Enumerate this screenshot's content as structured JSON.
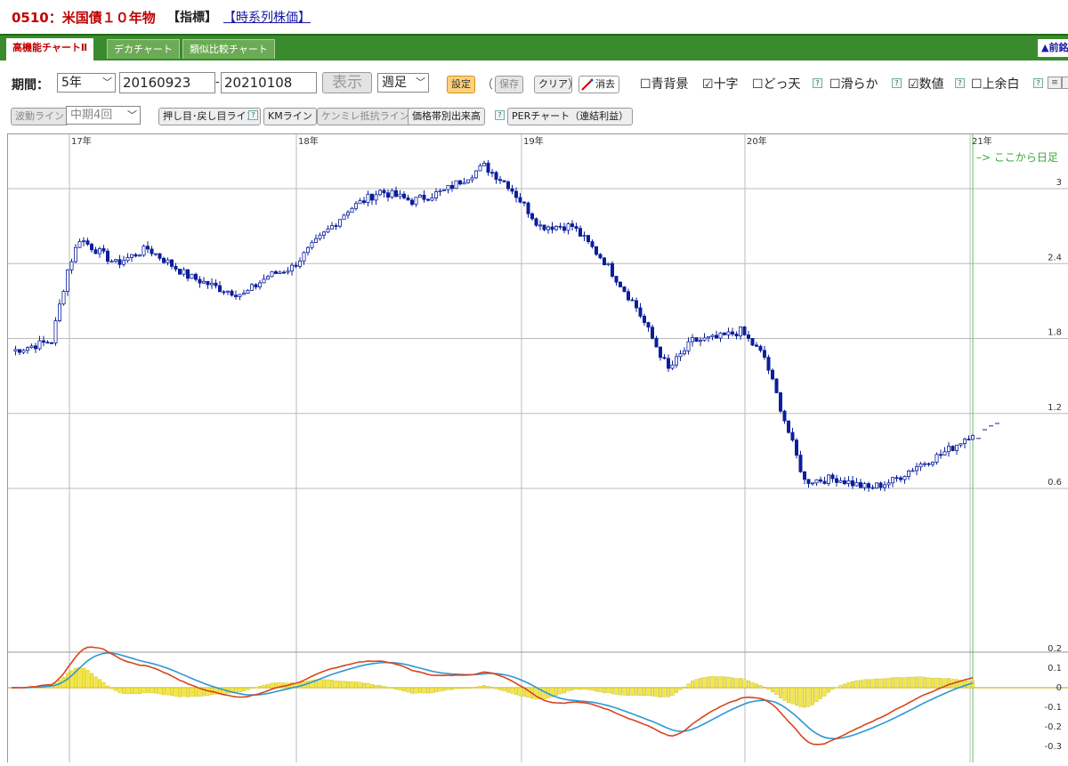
{
  "title": {
    "code_name": "0510：米国債１０年物",
    "tag": "【指標】",
    "link": "【時系列株価】"
  },
  "tabs": [
    {
      "label": "高機能チャートⅡ",
      "active": true
    },
    {
      "label": "デカチャート",
      "active": false
    },
    {
      "label": "類似比較チャート",
      "active": false
    }
  ],
  "prev_label": "▲前銘",
  "controls": {
    "period_label": "期間：",
    "period_value": "5年",
    "start_date": "20160923",
    "separator": "-",
    "end_date": "20210108",
    "show_label": "表示",
    "interval_value": "週足",
    "settings_label": "設定",
    "save_label": "保存",
    "clear_label": "クリア",
    "paren_open": "（",
    "paren_close": "）",
    "erase_label": "消去"
  },
  "toggles": [
    {
      "label": "青背景",
      "checked": false
    },
    {
      "label": "十字",
      "checked": true
    },
    {
      "label": "どっ天",
      "checked": false
    },
    {
      "label": "滑らか",
      "checked": false
    },
    {
      "label": "数値",
      "checked": true
    },
    {
      "label": "上余白",
      "checked": false
    }
  ],
  "tools": {
    "wave_label": "波動ライン",
    "mid_value": "中期4回",
    "push_label": "押し目･戻し目ライン",
    "km_label": "KMライン",
    "kenmire_label": "ケンミレ抵抗ライン",
    "price_volume_label": "価格帯別出来高",
    "per_label": "PERチャート（連結利益）"
  },
  "chart_data": {
    "type": "candlestick",
    "x_labels": [
      "17年",
      "18年",
      "19年",
      "20年",
      "21年"
    ],
    "price_ticks": [
      "3",
      "2.4",
      "1.8",
      "1.2",
      "0.6"
    ],
    "macd_ticks": [
      "0.2",
      "0.1",
      "0",
      "-0.1",
      "-0.2",
      "-0.3"
    ],
    "annotation": "–> ここから日足",
    "period": "2016-09-23 to 2021-01-08",
    "interval": "weekly",
    "price_ylim": [
      0.4,
      3.4
    ],
    "price_path": [
      [
        0,
        1.7
      ],
      [
        10,
        1.78
      ],
      [
        14,
        2.35
      ],
      [
        17,
        2.6
      ],
      [
        26,
        2.4
      ],
      [
        34,
        2.52
      ],
      [
        44,
        2.3
      ],
      [
        52,
        2.2
      ],
      [
        58,
        2.15
      ],
      [
        64,
        2.3
      ],
      [
        70,
        2.37
      ],
      [
        76,
        2.57
      ],
      [
        84,
        2.83
      ],
      [
        92,
        2.98
      ],
      [
        100,
        2.9
      ],
      [
        108,
        2.98
      ],
      [
        118,
        3.18
      ],
      [
        124,
        3.03
      ],
      [
        132,
        2.7
      ],
      [
        140,
        2.7
      ],
      [
        148,
        2.42
      ],
      [
        156,
        2.05
      ],
      [
        164,
        1.55
      ],
      [
        170,
        1.78
      ],
      [
        176,
        1.8
      ],
      [
        182,
        1.86
      ],
      [
        188,
        1.65
      ],
      [
        194,
        1.05
      ],
      [
        198,
        0.66
      ],
      [
        206,
        0.68
      ],
      [
        214,
        0.6
      ],
      [
        220,
        0.66
      ],
      [
        226,
        0.78
      ],
      [
        232,
        0.87
      ],
      [
        235,
        0.93
      ],
      [
        240,
        1.05
      ]
    ],
    "daily_values": [
      1.0,
      1.07,
      1.1,
      1.12
    ],
    "series": [
      {
        "name": "MACD",
        "color": "#d9441c"
      },
      {
        "name": "シグナル",
        "color": "#2b98d4"
      },
      {
        "name": "ヒストグラム",
        "color": "#f2e64a"
      }
    ],
    "up_color": "#ffffff",
    "down_color": "#0b1f9c"
  }
}
